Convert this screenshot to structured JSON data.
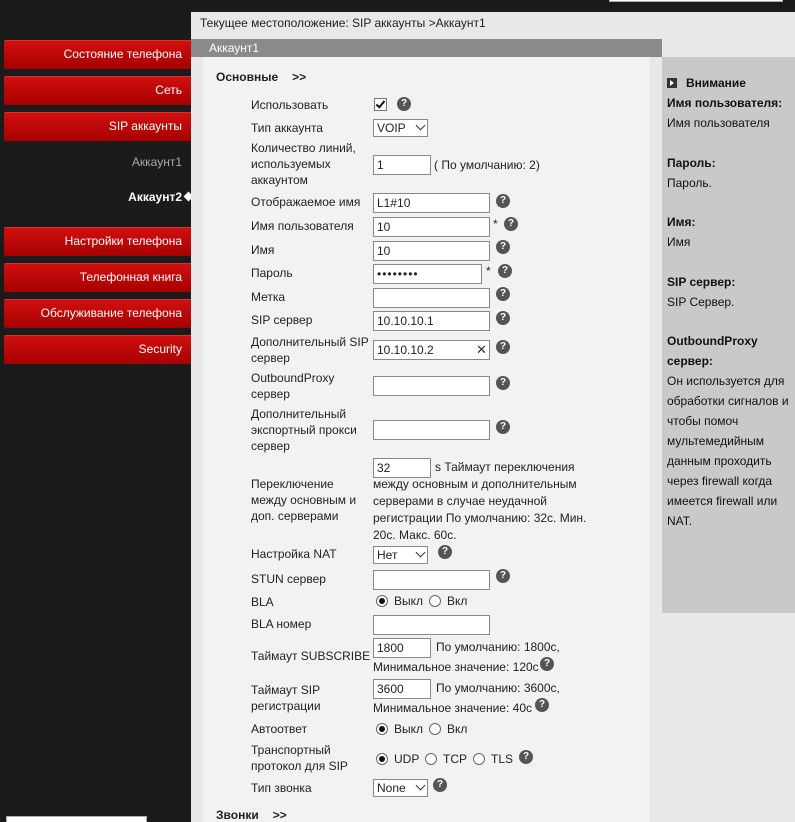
{
  "sidebar": {
    "items": [
      {
        "label": "Состояние телефона"
      },
      {
        "label": "Сеть"
      },
      {
        "label": "SIP аккаунты"
      },
      {
        "label": "Аккаунт1"
      },
      {
        "label": "Аккаунт2"
      },
      {
        "label": "Настройки телефона"
      },
      {
        "label": "Телефонная книга"
      },
      {
        "label": "Обслуживание телефона"
      },
      {
        "label": "Security"
      }
    ]
  },
  "header": {
    "breadcrumb": "Текущее местоположение: SIP аккаунты >Аккаунт1",
    "tab": "Аккаунт1"
  },
  "form": {
    "section_basic": "Основные",
    "section_calls": "Звонки",
    "section_arrow": ">>",
    "enable_label": "Использовать",
    "account_type_label": "Тип аккаунта",
    "account_type_value": "VOIP",
    "lines_label": "Количество линий, используемых аккаунтом",
    "lines_value": "1",
    "lines_hint": "( По умолчанию: 2)",
    "display_name_label": "Отображаемое имя",
    "display_name_value": "L1#10",
    "username_label": "Имя пользователя",
    "username_value": "10",
    "name_label": "Имя",
    "name_value": "10",
    "password_label": "Пароль",
    "password_value": "••••••••",
    "tag_label": "Метка",
    "tag_value": "",
    "sip_server_label": "SIP сервер",
    "sip_server_value": "10.10.10.1",
    "backup_sip_label": "Дополнительный SIP сервер",
    "backup_sip_value": "10.10.10.2",
    "outbound_label": "OutboundProxy сервер",
    "outbound_value": "",
    "backup_outbound_label": "Дополнительный экспортный прокси сервер",
    "backup_outbound_value": "",
    "failover_label": "Переключение между основным и доп. серверами",
    "failover_value": "32",
    "failover_hint": "s Таймаут переключения между основным и дополнительным серверами в случае неудачной регистрации По умолчанию: 32с. Мин. 20с. Макс. 60с.",
    "nat_label": "Настройка NAT",
    "nat_value": "Нет",
    "stun_label": "STUN сервер",
    "stun_value": "",
    "bla_label": "BLA",
    "bla_off": "Выкл",
    "bla_on": "Вкл",
    "bla_number_label": "BLA номер",
    "bla_number_value": "",
    "subscribe_label": "Таймаут SUBSCRIBE",
    "subscribe_value": "1800",
    "subscribe_hint_1": "По умолчанию: 1800с,",
    "subscribe_hint_2": "Минимальное значение: 120с",
    "reg_timeout_label": "Таймаут SIP регистрации",
    "reg_timeout_value": "3600",
    "reg_hint_1": "По умолчанию: 3600с,",
    "reg_hint_2": "Минимальное значение: 40с",
    "auto_answer_label": "Автоответ",
    "auto_off": "Выкл",
    "auto_on": "Вкл",
    "transport_label": "Транспортный протокол для SIP",
    "transport_udp": "UDP",
    "transport_tcp": "TCP",
    "transport_tls": "TLS",
    "ring_type_label": "Тип звонка",
    "ring_type_value": "None",
    "required_mark": "*",
    "help_glyph": "?",
    "clear_glyph": "✕"
  },
  "attention": {
    "title": "Внимание",
    "items": [
      {
        "heading": "Имя пользователя:",
        "text": "Имя пользователя"
      },
      {
        "heading": "Пароль:",
        "text": "Пароль."
      },
      {
        "heading": "Имя:",
        "text": "Имя"
      },
      {
        "heading": "SIP сервер:",
        "text": "SIP Сервер."
      },
      {
        "heading": "OutboundProxy сервер:",
        "text": "Он используется для обработки сигналов и чтобы помоч мультемедийным данным проходить через firewall когда имеется firewall или NAT."
      }
    ]
  }
}
